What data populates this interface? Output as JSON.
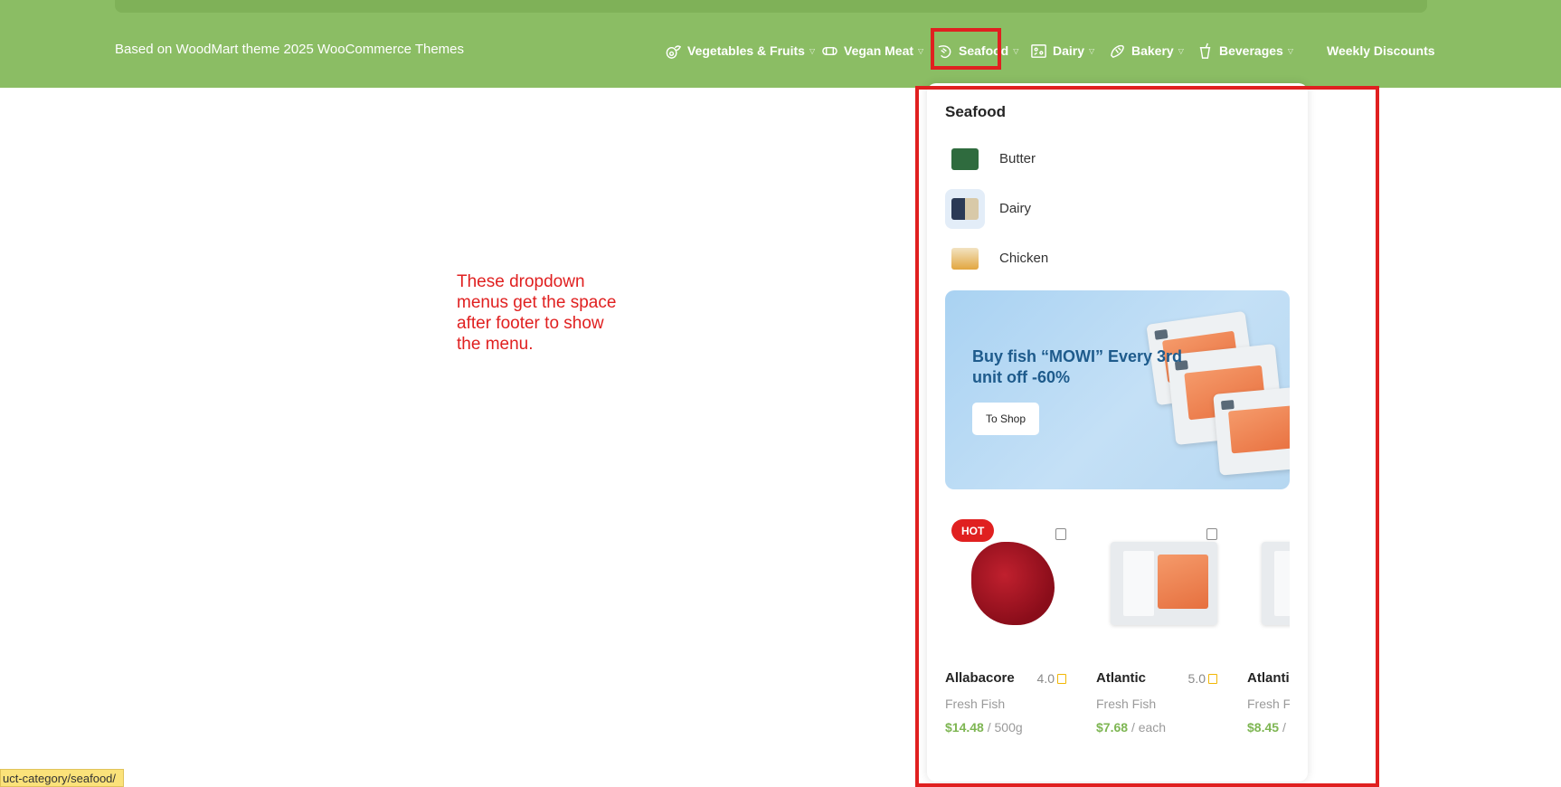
{
  "header": {
    "tagline": "Based on WoodMart theme 2025 WooCommerce Themes",
    "nav": [
      {
        "label": "Vegetables & Fruits",
        "icon": "avocado-icon"
      },
      {
        "label": "Vegan Meat",
        "icon": "sausage-icon"
      },
      {
        "label": "Seafood",
        "icon": "shrimp-icon"
      },
      {
        "label": "Dairy",
        "icon": "cheese-icon"
      },
      {
        "label": "Bakery",
        "icon": "croissant-icon"
      },
      {
        "label": "Beverages",
        "icon": "cup-icon"
      },
      {
        "label": "Weekly Discounts",
        "icon": ""
      }
    ]
  },
  "annotation": {
    "text": "These dropdown menus get the space after footer to show the menu.",
    "color": "#e02020"
  },
  "dropdown": {
    "title": "Seafood",
    "categories": [
      {
        "label": "Butter"
      },
      {
        "label": "Dairy"
      },
      {
        "label": "Chicken"
      }
    ],
    "banner": {
      "title": "Buy fish “MOWI” Every 3rd unit off -60%",
      "button": "To Shop"
    },
    "products": [
      {
        "name": "Allabacore",
        "rating": "4.0",
        "category": "Fresh Fish",
        "price": "$14.48",
        "unit": "/ 500g",
        "badge": "HOT"
      },
      {
        "name": "Atlantic",
        "rating": "5.0",
        "category": "Fresh Fish",
        "price": "$7.68",
        "unit": "/ each",
        "badge": ""
      },
      {
        "name": "Atlantic",
        "rating": "",
        "category": "Fresh Fish",
        "price": "$8.45",
        "unit": "/ each",
        "badge": ""
      }
    ]
  },
  "status_bar": {
    "url": "uct-category/seafood/"
  },
  "colors": {
    "header_bg": "#8bbd64",
    "price_green": "#7eb653",
    "badge_red": "#e02020",
    "banner_title": "#1e5b8c"
  }
}
